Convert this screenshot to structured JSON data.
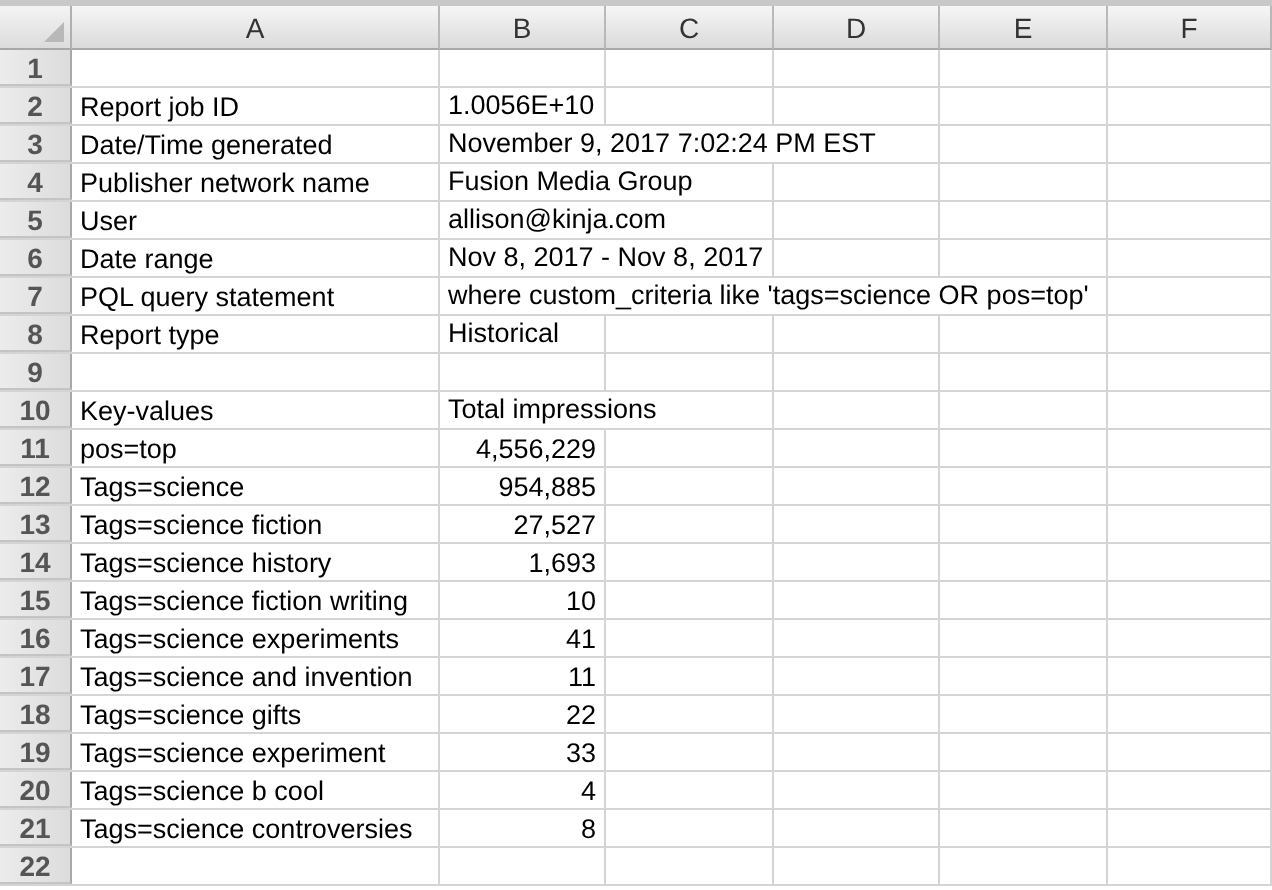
{
  "sheet": {
    "columns": [
      "A",
      "B",
      "C",
      "D",
      "E",
      "F"
    ],
    "rows": [
      {
        "number": "1"
      },
      {
        "number": "2",
        "label": "Report job ID",
        "value": "1.0056E+10",
        "kind": "text"
      },
      {
        "number": "3",
        "label": "Date/Time generated",
        "value": "November 9, 2017 7:02:24 PM EST",
        "kind": "text"
      },
      {
        "number": "4",
        "label": "Publisher network name",
        "value": "Fusion Media Group",
        "kind": "text"
      },
      {
        "number": "5",
        "label": "User",
        "value": "allison@kinja.com",
        "kind": "text"
      },
      {
        "number": "6",
        "label": "Date range",
        "value": "Nov 8, 2017 - Nov 8, 2017",
        "kind": "text"
      },
      {
        "number": "7",
        "label": "PQL query statement",
        "value": "where custom_criteria like 'tags=science OR pos=top'",
        "kind": "text"
      },
      {
        "number": "8",
        "label": "Report type",
        "value": "Historical",
        "kind": "text"
      },
      {
        "number": "9"
      },
      {
        "number": "10",
        "label": "Key-values",
        "value": "Total impressions",
        "kind": "text"
      },
      {
        "number": "11",
        "label": "pos=top",
        "value": "4,556,229",
        "kind": "number"
      },
      {
        "number": "12",
        "label": "Tags=science",
        "value": "954,885",
        "kind": "number"
      },
      {
        "number": "13",
        "label": "Tags=science fiction",
        "value": "27,527",
        "kind": "number"
      },
      {
        "number": "14",
        "label": "Tags=science history",
        "value": "1,693",
        "kind": "number"
      },
      {
        "number": "15",
        "label": "Tags=science fiction writing",
        "value": "10",
        "kind": "number"
      },
      {
        "number": "16",
        "label": "Tags=science experiments",
        "value": "41",
        "kind": "number"
      },
      {
        "number": "17",
        "label": "Tags=science and invention",
        "value": "11",
        "kind": "number"
      },
      {
        "number": "18",
        "label": "Tags=science gifts",
        "value": "22",
        "kind": "number"
      },
      {
        "number": "19",
        "label": "Tags=science experiment",
        "value": "33",
        "kind": "number"
      },
      {
        "number": "20",
        "label": "Tags=science b cool",
        "value": "4",
        "kind": "number"
      },
      {
        "number": "21",
        "label": "Tags=science controversies",
        "value": "8",
        "kind": "number"
      },
      {
        "number": "22"
      }
    ]
  }
}
